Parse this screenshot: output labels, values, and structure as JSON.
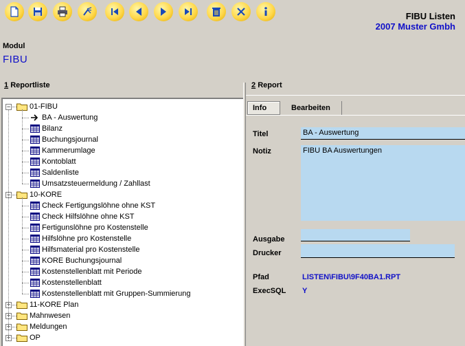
{
  "app": {
    "title": "FIBU Listen",
    "company": "2007 Muster Gmbh"
  },
  "toolbar": {
    "buttons": [
      {
        "name": "new-document-icon"
      },
      {
        "name": "save-icon"
      },
      {
        "name": "print-icon"
      },
      {
        "name": "broom-icon"
      },
      {
        "name": "first-record-icon"
      },
      {
        "name": "previous-record-icon"
      },
      {
        "name": "next-record-icon"
      },
      {
        "name": "last-record-icon"
      },
      {
        "name": "trash-icon"
      },
      {
        "name": "close-icon"
      },
      {
        "name": "info-icon"
      }
    ],
    "button_color": "#ffd84a"
  },
  "module": {
    "label": "Modul",
    "value": "FIBU"
  },
  "left_section": {
    "number": "1",
    "title": "Reportliste"
  },
  "right_section": {
    "number": "2",
    "title": "Report"
  },
  "tree": [
    {
      "label": "01-FIBU",
      "type": "folder",
      "expanded": true,
      "children": [
        "BA - Auswertung",
        "Bilanz",
        "Buchungsjournal",
        "Kammerumlage",
        "Kontoblatt",
        "Saldenliste",
        "Umsatzsteuermeldung / Zahllast"
      ]
    },
    {
      "label": "10-KORE",
      "type": "folder",
      "expanded": true,
      "children": [
        "Check Fertigungslöhne ohne KST",
        "Check Hilfslöhne ohne KST",
        "Fertigunslöhne pro Kostenstelle",
        "Hilfslöhne pro Kostenstelle",
        "Hilfsmaterial pro Kostenstelle",
        "KORE Buchungsjournal",
        "Kostenstellenblatt mit Periode",
        "Kostenstellenblatt",
        "Kostenstellenblatt mit Gruppen-Summierung"
      ]
    },
    {
      "label": "11-KORE Plan",
      "type": "folder",
      "expanded": false,
      "children": []
    },
    {
      "label": "Mahnwesen",
      "type": "folder",
      "expanded": false,
      "children": []
    },
    {
      "label": "Meldungen",
      "type": "folder",
      "expanded": false,
      "children": []
    },
    {
      "label": "OP",
      "type": "folder",
      "expanded": false,
      "children": []
    }
  ],
  "tabs": [
    {
      "label": "Info",
      "active": true
    },
    {
      "label": "Bearbeiten",
      "active": false
    }
  ],
  "fields": {
    "titel_label": "Titel",
    "titel_value": "BA - Auswertung",
    "notiz_label": "Notiz",
    "notiz_value": "FIBU BA Auswertungen",
    "ausgabe_label": "Ausgabe",
    "ausgabe_value": "",
    "drucker_label": "Drucker",
    "drucker_value": "",
    "pfad_label": "Pfad",
    "pfad_value": "LISTEN\\FIBU\\9F40BA1.RPT",
    "execsql_label": "ExecSQL",
    "execsql_value": "Y"
  },
  "colors": {
    "accent_blue": "#1010c8",
    "field_bg": "#b8d9f0",
    "window_bg": "#d4d0c8"
  }
}
